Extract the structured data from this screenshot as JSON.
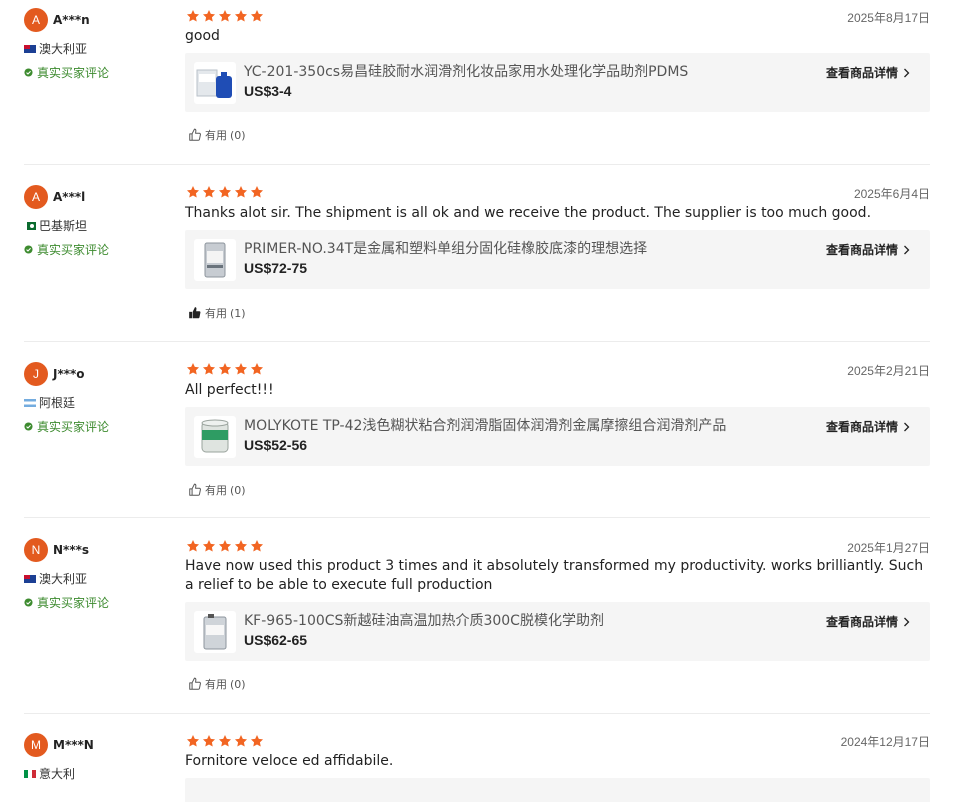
{
  "common": {
    "verified_label": "真实买家评论",
    "view_details_label": "查看商品详情",
    "useful_label": "有用"
  },
  "colors": {
    "accent": "#e35a1f",
    "star": "#f26522",
    "verified": "#3d8b2f"
  },
  "reviews": [
    {
      "avatar": "A",
      "name": "A***n",
      "country": "澳大利亚",
      "flag": "australia-flag-icon",
      "rating": 5,
      "date": "2025年8月17日",
      "comment": "good",
      "product": {
        "name": "YC-201-350cs易昌硅胶耐水润滑剂化妆品家用水处理化学品助剂PDMS",
        "price": "US$3-4"
      },
      "useful_count": "(0)"
    },
    {
      "avatar": "A",
      "name": "A***l",
      "country": "巴基斯坦",
      "flag": "pakistan-flag-icon",
      "rating": 5,
      "date": "2025年6月4日",
      "comment": "Thanks alot sir. The shipment is all ok and we receive the product. The supplier is too much good.",
      "product": {
        "name": "PRIMER-NO.34T是金属和塑料单组分固化硅橡胶底漆的理想选择",
        "price": "US$72-75"
      },
      "useful_count": "(1)"
    },
    {
      "avatar": "J",
      "name": "J***o",
      "country": "阿根廷",
      "flag": "argentina-flag-icon",
      "rating": 5,
      "date": "2025年2月21日",
      "comment": "All perfect!!!",
      "product": {
        "name": "MOLYKOTE TP-42浅色糊状粘合剂润滑脂固体润滑剂金属摩擦组合润滑剂产品",
        "price": "US$52-56"
      },
      "useful_count": "(0)"
    },
    {
      "avatar": "N",
      "name": "N***s",
      "country": "澳大利亚",
      "flag": "australia-flag-icon",
      "rating": 5,
      "date": "2025年1月27日",
      "comment": "Have now used this product 3 times and it absolutely transformed my productivity. works brilliantly. Such a relief to be able to execute full production",
      "product": {
        "name": "KF-965-100CS新越硅油高温加热介质300C脱模化学助剂",
        "price": "US$62-65"
      },
      "useful_count": "(0)"
    },
    {
      "avatar": "M",
      "name": "M***N",
      "country": "意大利",
      "flag": "italy-flag-icon",
      "rating": 5,
      "date": "2024年12月17日",
      "comment": "Fornitore veloce ed affidabile."
    }
  ]
}
